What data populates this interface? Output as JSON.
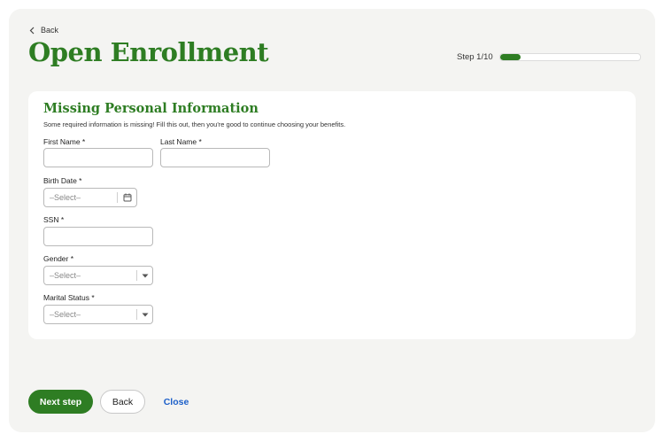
{
  "nav": {
    "back_label": "Back"
  },
  "header": {
    "title": "Open Enrollment",
    "step_label": "Step 1/10",
    "progress_fraction": 0.15
  },
  "card": {
    "title": "Missing Personal Information",
    "subtitle": "Some required information is missing! Fill this out, then you're good to continue choosing your benefits.",
    "fields": {
      "first_name": {
        "label": "First Name *",
        "value": ""
      },
      "last_name": {
        "label": "Last Name *",
        "value": ""
      },
      "birth_date": {
        "label": "Birth Date *",
        "placeholder": "–Select–"
      },
      "ssn": {
        "label": "SSN *",
        "value": ""
      },
      "gender": {
        "label": "Gender *",
        "placeholder": "–Select–"
      },
      "marital_status": {
        "label": "Marital Status *",
        "placeholder": "–Select–"
      }
    }
  },
  "footer": {
    "next_label": "Next step",
    "back_label": "Back",
    "close_label": "Close"
  },
  "colors": {
    "brand_green": "#2e7d23",
    "link_blue": "#1c5fc9",
    "panel_bg": "#f4f4f2"
  },
  "icons": {
    "back": "chevron-left-icon",
    "date": "calendar-icon",
    "dropdown": "caret-down-icon"
  }
}
